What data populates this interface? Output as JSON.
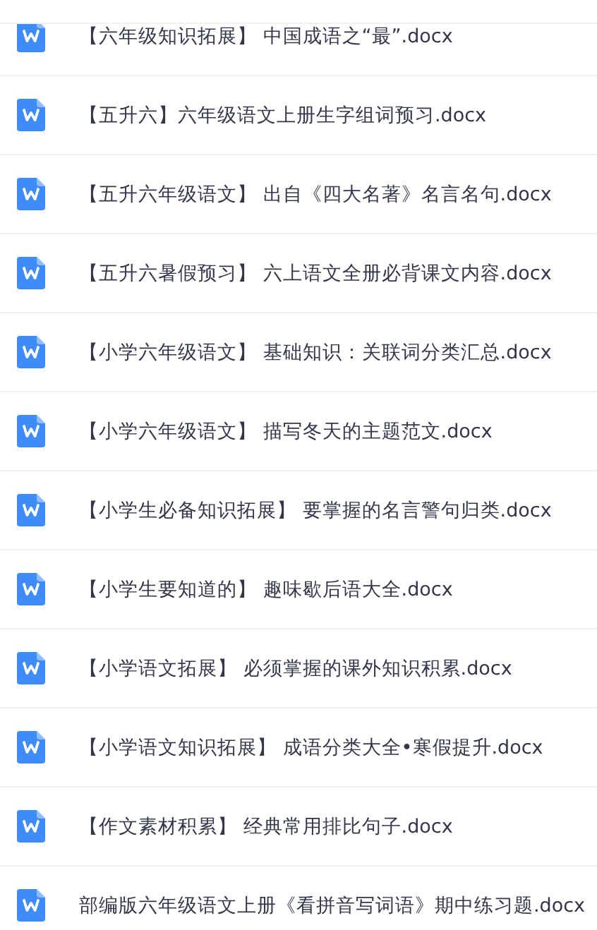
{
  "files": [
    {
      "name": "【六年级知识拓展】 中国成语之“最”.docx"
    },
    {
      "name": "【五升六】六年级语文上册生字组词预习.docx"
    },
    {
      "name": "【五升六年级语文】 出自《四大名著》名言名句.docx"
    },
    {
      "name": "【五升六暑假预习】 六上语文全册必背课文内容.docx"
    },
    {
      "name": "【小学六年级语文】 基础知识：关联词分类汇总.docx"
    },
    {
      "name": "【小学六年级语文】 描写冬天的主题范文.docx"
    },
    {
      "name": "【小学生必备知识拓展】 要掌握的名言警句归类.docx"
    },
    {
      "name": "【小学生要知道的】 趣味歇后语大全.docx"
    },
    {
      "name": "【小学语文拓展】 必须掌握的课外知识积累.docx"
    },
    {
      "name": "【小学语文知识拓展】 成语分类大全•寒假提升.docx"
    },
    {
      "name": "【作文素材积累】 经典常用排比句子.docx"
    },
    {
      "name": "部编版六年级语文上册《看拼音写词语》期中练习题.docx"
    }
  ]
}
